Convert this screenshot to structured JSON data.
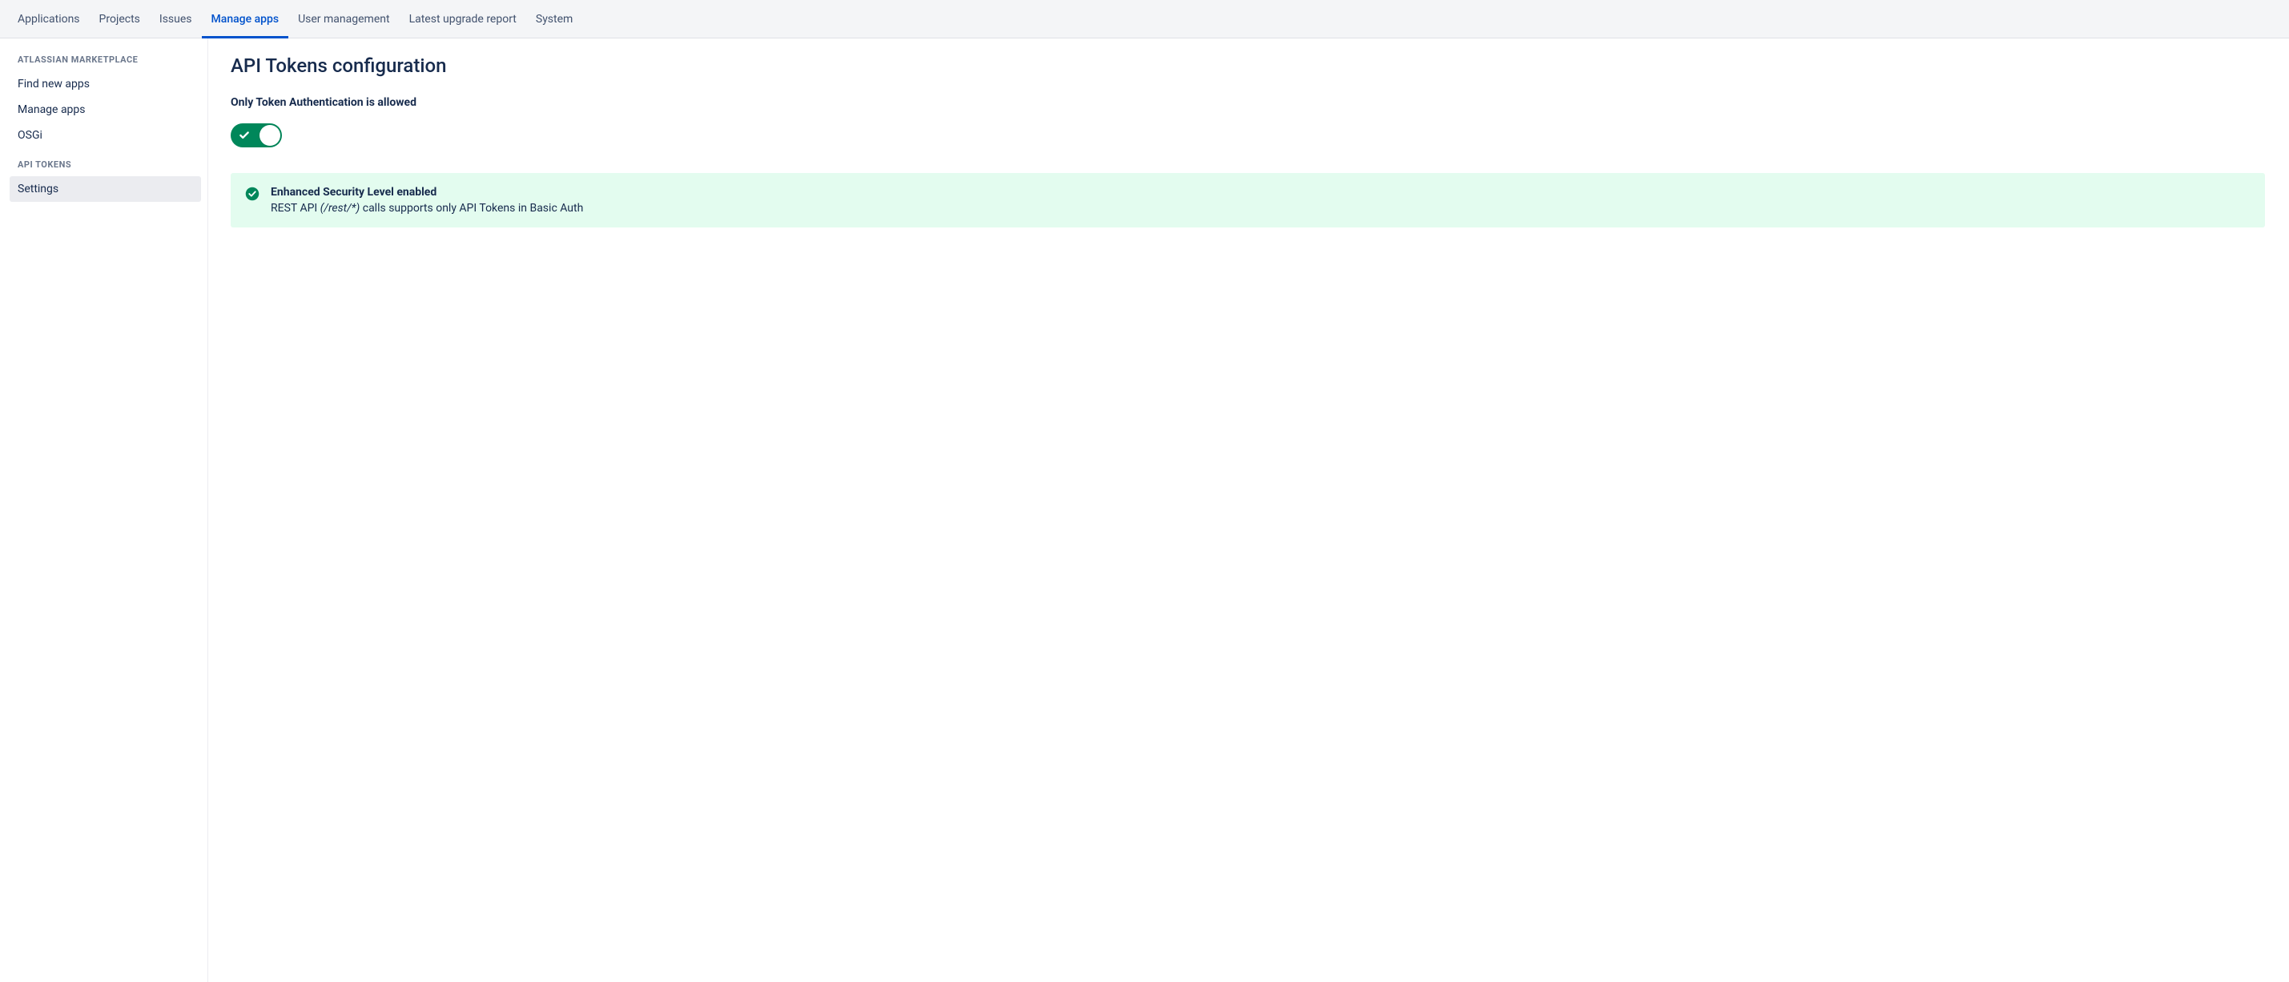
{
  "topnav": {
    "items": [
      {
        "label": "Applications",
        "active": false
      },
      {
        "label": "Projects",
        "active": false
      },
      {
        "label": "Issues",
        "active": false
      },
      {
        "label": "Manage apps",
        "active": true
      },
      {
        "label": "User management",
        "active": false
      },
      {
        "label": "Latest upgrade report",
        "active": false
      },
      {
        "label": "System",
        "active": false
      }
    ]
  },
  "sidebar": {
    "sections": [
      {
        "header": "Atlassian Marketplace",
        "items": [
          {
            "label": "Find new apps",
            "active": false
          },
          {
            "label": "Manage apps",
            "active": false
          },
          {
            "label": "OSGi",
            "active": false
          }
        ]
      },
      {
        "header": "API Tokens",
        "items": [
          {
            "label": "Settings",
            "active": true
          }
        ]
      }
    ]
  },
  "main": {
    "title": "API Tokens configuration",
    "toggleSection": {
      "label": "Only Token Authentication is allowed",
      "enabled": true
    },
    "banner": {
      "title": "Enhanced Security Level enabled",
      "desc_prefix": "REST API ",
      "desc_italic": "(/rest/*)",
      "desc_suffix": " calls supports only API Tokens in Basic Auth"
    }
  }
}
